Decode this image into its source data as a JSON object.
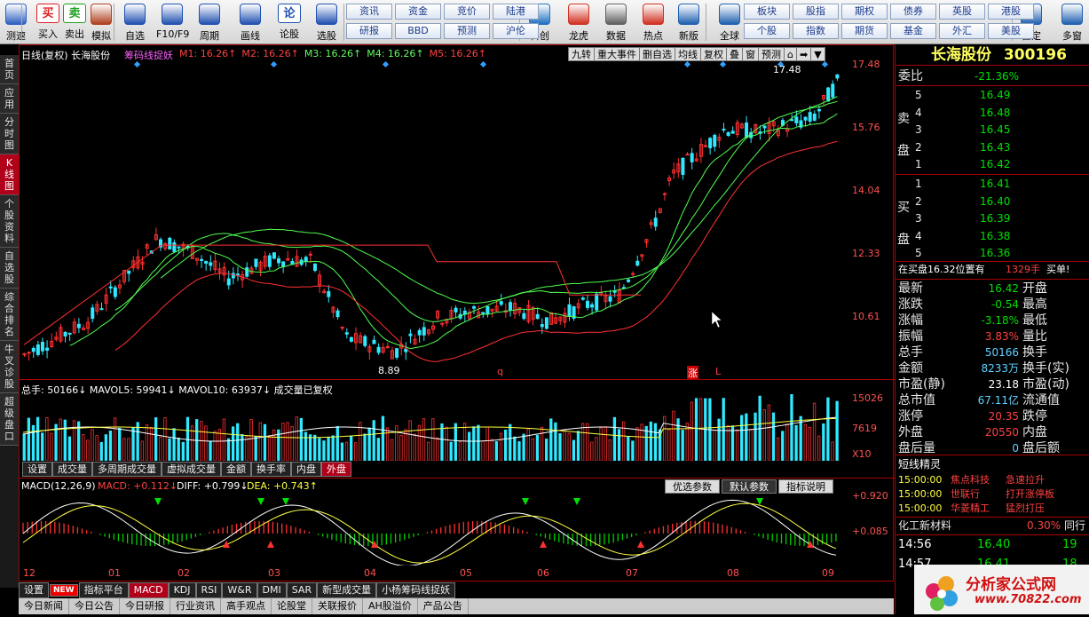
{
  "toolbar": {
    "items": [
      {
        "label": "测速",
        "icon": "clock-icon"
      },
      {
        "label": "买入",
        "glyph": "买"
      },
      {
        "label": "卖出",
        "glyph": "卖"
      },
      {
        "label": "模拟",
        "icon": "hammer-icon"
      },
      {
        "label": "自选",
        "icon": "star-icon"
      },
      {
        "label": "F10/F9",
        "icon": "f10-icon"
      },
      {
        "label": "周期",
        "icon": "period-icon"
      },
      {
        "label": "画线",
        "icon": "pencil-icon"
      },
      {
        "label": "论股",
        "glyph": "论"
      },
      {
        "label": "选股",
        "icon": "select-stock-icon"
      },
      {
        "label": "科创",
        "icon": "kc-icon"
      },
      {
        "label": "龙虎",
        "icon": "dragon-icon"
      },
      {
        "label": "数据",
        "icon": "pe-icon"
      },
      {
        "label": "热点",
        "icon": "hot-icon"
      },
      {
        "label": "新版",
        "icon": "new-version-icon"
      },
      {
        "label": "全球",
        "icon": "globe-icon"
      },
      {
        "label": "自定",
        "icon": "custom-icon"
      },
      {
        "label": "多窗",
        "icon": "multi-window-icon"
      }
    ],
    "grid1": [
      [
        "资讯",
        "资金",
        "竞价",
        "陆港"
      ],
      [
        "研报",
        "BBD",
        "预测",
        "沪伦"
      ]
    ],
    "grid2": [
      [
        "板块",
        "股指",
        "期权",
        "债券",
        "英股",
        "港股"
      ],
      [
        "个股",
        "指数",
        "期货",
        "基金",
        "外汇",
        "美股"
      ]
    ]
  },
  "lefttabs": [
    "首页",
    "应用",
    "分时图",
    "K线图",
    "个股资料",
    "自选股",
    "综合排名",
    "牛叉诊股",
    "超级盘口"
  ],
  "kchart": {
    "header": "日线(复权) 长海股份",
    "indicator": "筹码线捉妖",
    "ma": [
      {
        "label": "M1: 16.26↑",
        "color": "#ff4040"
      },
      {
        "label": "M2: 16.26↑",
        "color": "#ff4040"
      },
      {
        "label": "M3: 16.26↑",
        "color": "#60ff60"
      },
      {
        "label": "M4: 16.26↑",
        "color": "#60ff60"
      },
      {
        "label": "M5: 16.26↑",
        "color": "#ff4040"
      }
    ],
    "buttons": [
      "九转",
      "重大事件",
      "删自选",
      "均线",
      "复权",
      "叠",
      "窗",
      "预测"
    ],
    "yaxis": [
      "17.48",
      "15.76",
      "14.04",
      "12.33",
      "10.61"
    ],
    "high_label": "17.48",
    "low_label": "8.89",
    "markers": [
      "q",
      "涨",
      "L"
    ]
  },
  "volume": {
    "header": "总手: 50166↓  MAVOL5: 59941↓  MAVOL10: 63937↓  成交量已复权",
    "yaxis": [
      "15026",
      "7619",
      "X10"
    ],
    "tabs": [
      "设置",
      "成交量",
      "多周期成交量",
      "虚拟成交量",
      "金额",
      "换手率",
      "内盘",
      "外盘"
    ],
    "active_tab": "外盘"
  },
  "macd": {
    "title": "MACD(12,26,9)",
    "macd": "MACD: +0.112↓",
    "diff": "DIFF: +0.799↓",
    "dea": "DEA: +0.743↑",
    "buttons": [
      "优选参数",
      "默认参数",
      "指标说明"
    ],
    "yaxis": [
      "+0.920",
      "+0.085"
    ]
  },
  "xaxis": [
    "12",
    "01",
    "02",
    "03",
    "04",
    "05",
    "06",
    "07",
    "08",
    "09"
  ],
  "bottomtabs": [
    "设置",
    "指标平台",
    "MACD",
    "KDJ",
    "RSI",
    "W&R",
    "DMI",
    "SAR",
    "新型成交量",
    "小杨筹码线捉妖"
  ],
  "statusbar": [
    "今日新闻",
    "今日公告",
    "今日研报",
    "行业资讯",
    "高手观点",
    "论股堂",
    "关联报价",
    "AH股溢价",
    "产品公告"
  ],
  "quote": {
    "name": "长海股份",
    "code": "300196",
    "weibi": {
      "k": "委比",
      "v": "-21.36%"
    },
    "sell_label": "卖盘",
    "buy_label": "买盘",
    "asks": [
      [
        "5",
        "16.49"
      ],
      [
        "4",
        "16.48"
      ],
      [
        "3",
        "16.45"
      ],
      [
        "2",
        "16.43"
      ],
      [
        "1",
        "16.42"
      ]
    ],
    "bids": [
      [
        "1",
        "16.41"
      ],
      [
        "2",
        "16.40"
      ],
      [
        "3",
        "16.39"
      ],
      [
        "4",
        "16.38"
      ],
      [
        "5",
        "16.36"
      ]
    ],
    "note": "在买盘16.32位置有",
    "note_qty": "1329手",
    "note_tail": "买单!",
    "stats": [
      [
        "最新",
        "16.42",
        "开盘"
      ],
      [
        "涨跌",
        "-0.54",
        "最高"
      ],
      [
        "涨幅",
        "-3.18%",
        "最低"
      ],
      [
        "振幅",
        "3.83%",
        "量比"
      ],
      [
        "总手",
        "50166",
        "换手"
      ],
      [
        "金额",
        "8233万",
        "换手(实)"
      ],
      [
        "市盈(静)",
        "23.18",
        "市盈(动)"
      ],
      [
        "总市值",
        "67.11亿",
        "流通值"
      ],
      [
        "涨停",
        "20.35",
        "跌停"
      ],
      [
        "外盘",
        "20550",
        "内盘"
      ],
      [
        "盘后量",
        "0",
        "盘后额"
      ]
    ],
    "sprite_title": "短线精灵",
    "sprite": [
      [
        "15:00:00",
        "焦点科技",
        "急速拉升"
      ],
      [
        "15:00:00",
        "世联行",
        "打开涨停板"
      ],
      [
        "15:00:00",
        "华菱精工",
        "猛烈打压"
      ]
    ],
    "sector": {
      "name": "化工新材料",
      "pct": "0.30%",
      "tail": "同行"
    },
    "ticks": [
      [
        "14:56",
        "16.40",
        "19"
      ],
      [
        "14:57",
        "16.41",
        "18"
      ]
    ]
  },
  "watermark": {
    "site": "分析家公式网",
    "url": "www.70822.com"
  },
  "colors": {
    "up": "#ff3030",
    "down": "#00ffff",
    "bg": "#000000",
    "frame": "#aa0000",
    "accent": "#ffff40"
  }
}
